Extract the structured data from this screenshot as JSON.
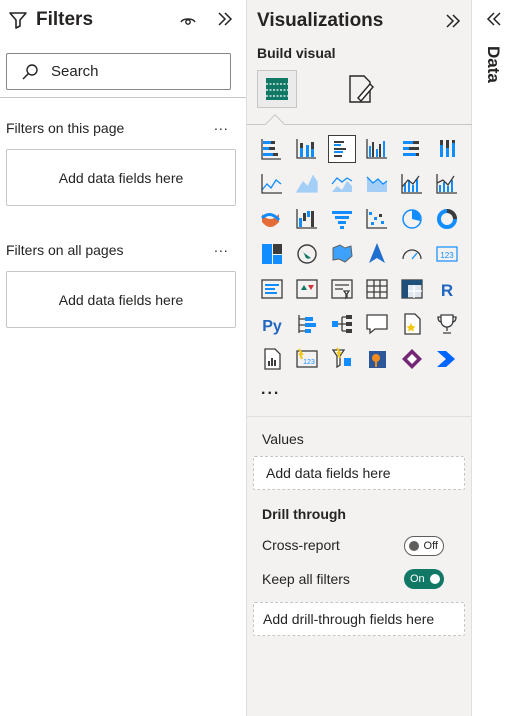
{
  "filters": {
    "title": "Filters",
    "search_placeholder": "Search",
    "page_section": {
      "label": "Filters on this page",
      "more": "...",
      "well": "Add data fields here"
    },
    "all_section": {
      "label": "Filters on all pages",
      "more": "...",
      "well": "Add data fields here"
    }
  },
  "visualizations": {
    "title": "Visualizations",
    "build_visual": "Build visual",
    "icons": [
      "stacked-bar-chart-icon",
      "stacked-column-chart-icon",
      "clustered-bar-chart-icon",
      "clustered-column-chart-icon",
      "100-stacked-bar-chart-icon",
      "100-stacked-column-chart-icon",
      "line-chart-icon",
      "area-chart-icon",
      "stacked-area-chart-icon",
      "100-stacked-area-chart-icon",
      "line-and-stacked-column-icon",
      "line-and-clustered-column-icon",
      "ribbon-chart-icon",
      "waterfall-chart-icon",
      "funnel-icon",
      "scatter-chart-icon",
      "pie-chart-icon",
      "donut-chart-icon",
      "treemap-icon",
      "map-icon",
      "filled-map-icon",
      "azure-map-icon",
      "gauge-icon",
      "card-icon",
      "multi-row-card-icon",
      "kpi-icon",
      "slicer-icon",
      "table-icon",
      "matrix-icon",
      "r-script-icon",
      "python-visual-icon",
      "key-influencers-icon",
      "decomposition-tree-icon",
      "qa-icon",
      "smart-narrative-icon",
      "metrics-icon",
      "paginated-report-icon",
      "power-apps-icon",
      "power-automate-icon",
      "arcgis-map-icon",
      "power-apps-diamond-icon",
      "power-automate-arrow-icon"
    ],
    "more_visuals": "...",
    "values_label": "Values",
    "values_well": "Add data fields here",
    "drill_through": "Drill through",
    "cross_report": {
      "label": "Cross-report",
      "state": "Off"
    },
    "keep_all_filters": {
      "label": "Keep all filters",
      "state": "On"
    },
    "drill_well": "Add drill-through fields here",
    "colors": {
      "blue": "#118dff",
      "dark": "#3c3c3c",
      "toggle_on": "#117865"
    }
  },
  "data_pane": {
    "title": "Data"
  }
}
